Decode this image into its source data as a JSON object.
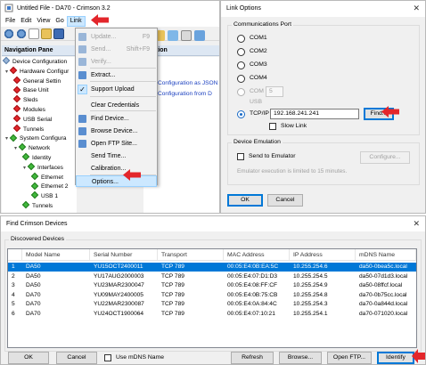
{
  "main_window": {
    "title": "Untitled File - DA70 - Crimson 3.2",
    "menu": [
      "File",
      "Edit",
      "View",
      "Go",
      "Link"
    ],
    "nav_pane_title": "Navigation Pane",
    "right_header": "tion",
    "right_lines": [
      "Configuration as JSON",
      "Configuration from D"
    ],
    "tree": [
      {
        "label": "Device Configuration",
        "icon": "none"
      },
      {
        "label": "Hardware Configur",
        "icon": "red",
        "twisty": "▾"
      },
      {
        "label": "General Settin",
        "icon": "red"
      },
      {
        "label": "Base Unit",
        "icon": "red"
      },
      {
        "label": "Sleds",
        "icon": "red"
      },
      {
        "label": "Modules",
        "icon": "red"
      },
      {
        "label": "USB Serial",
        "icon": "red"
      },
      {
        "label": "Tunnels",
        "icon": "red"
      },
      {
        "label": "System Configura",
        "icon": "green",
        "twisty": "▾"
      },
      {
        "label": "Network",
        "icon": "green",
        "twisty": "▾"
      },
      {
        "label": "Identity",
        "icon": "green"
      },
      {
        "label": "Interfaces",
        "icon": "green",
        "twisty": "▾"
      },
      {
        "label": "Ethernet",
        "icon": "green"
      },
      {
        "label": "Ethernet 2",
        "icon": "green"
      },
      {
        "label": "USB 1",
        "icon": "green"
      },
      {
        "label": "Tunnels",
        "icon": "green"
      }
    ]
  },
  "link_menu": {
    "items": [
      {
        "label": "Update...",
        "shortcut": "F9",
        "disabled": true
      },
      {
        "label": "Send...",
        "shortcut": "Shift+F9",
        "disabled": true
      },
      {
        "label": "Verify...",
        "shortcut": "",
        "disabled": true
      },
      {
        "label": "Extract...",
        "shortcut": "",
        "disabled": false
      },
      {
        "label": "Support Upload",
        "shortcut": "",
        "disabled": false,
        "checked": true
      },
      {
        "label": "Clear Credentials",
        "shortcut": "",
        "disabled": false
      },
      {
        "label": "Find Device...",
        "shortcut": "",
        "disabled": false
      },
      {
        "label": "Browse Device...",
        "shortcut": "",
        "disabled": false
      },
      {
        "label": "Open FTP Site...",
        "shortcut": "",
        "disabled": false
      },
      {
        "label": "Send Time...",
        "shortcut": "",
        "disabled": false
      },
      {
        "label": "Calibration...",
        "shortcut": "",
        "disabled": false
      },
      {
        "label": "Options...",
        "shortcut": "",
        "disabled": false,
        "highlighted": true
      }
    ]
  },
  "link_options": {
    "title": "Link Options",
    "comm_group": "Communications Port",
    "ports": [
      "COM1",
      "COM2",
      "COM3",
      "COM4",
      "COM",
      "USB",
      "TCP/IP"
    ],
    "com_number": "5",
    "ip_address": "192.168.241.241",
    "find_label": "Find...",
    "slow_link": "Slow Link",
    "emu_group": "Device Emulation",
    "send_to_emulator": "Send to Emulator",
    "configure_label": "Configure...",
    "emu_note": "Emulator execution is limited to 15 minutes.",
    "ok": "OK",
    "cancel": "Cancel"
  },
  "find_devices": {
    "title": "Find Crimson Devices",
    "group": "Discovered Devices",
    "columns": [
      "Model Name",
      "Serial Number",
      "Transport",
      "MAC Address",
      "IP Address",
      "mDNS Name"
    ],
    "rows": [
      [
        "DA50",
        "YU15OCT2400011",
        "TCP 789",
        "00:05:E4:0B:EA:5C",
        "10.255.254.6",
        "da50-0bea5c.local"
      ],
      [
        "DA50",
        "YU17AUG2000003",
        "TCP 789",
        "00:05:E4:07:D1:D3",
        "10.255.254.5",
        "da50-07d1d3.local"
      ],
      [
        "DA50",
        "YU23MAR2300047",
        "TCP 789",
        "00:05:E4:08:FF:CF",
        "10.255.254.9",
        "da50-08ffcf.local"
      ],
      [
        "DA70",
        "YU09MAY2400005",
        "TCP 789",
        "00:05:E4:0B:75:CB",
        "10.255.254.8",
        "da70-0b75cc.local"
      ],
      [
        "DA70",
        "YU22MAR2300087",
        "TCP 789",
        "00:05:E4:0A:84:4C",
        "10.255.254.3",
        "da70-0a844d.local"
      ],
      [
        "DA70",
        "YU24OCT1900064",
        "TCP 789",
        "00:05:E4:07:10:21",
        "10.255.254.1",
        "da70-071020.local"
      ]
    ],
    "row_numbers": [
      "1",
      "2",
      "3",
      "4",
      "5",
      "6"
    ],
    "ok": "OK",
    "cancel": "Cancel",
    "use_mdns": "Use mDNS Name",
    "refresh": "Refresh",
    "browse": "Browse...",
    "open_ftp": "Open FTP...",
    "identify": "Identify"
  },
  "colors": {
    "accent": "#0078d7",
    "arrow": "#e3262b"
  }
}
